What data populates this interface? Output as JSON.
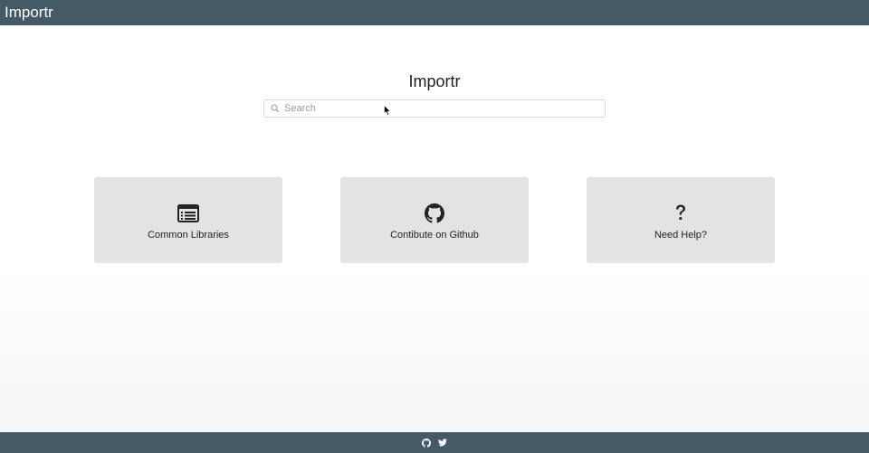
{
  "header": {
    "brand": "Importr"
  },
  "main": {
    "title": "Importr",
    "search": {
      "placeholder": "Search",
      "value": ""
    },
    "cards": [
      {
        "label": "Common Libraries",
        "icon": "list-icon"
      },
      {
        "label": "Contibute on Github",
        "icon": "github-icon"
      },
      {
        "label": "Need Help?",
        "icon": "question-icon"
      }
    ]
  },
  "footer": {
    "icons": [
      "github-icon",
      "twitter-icon"
    ]
  },
  "colors": {
    "bar": "#455a67",
    "card": "#e3e3e4"
  }
}
